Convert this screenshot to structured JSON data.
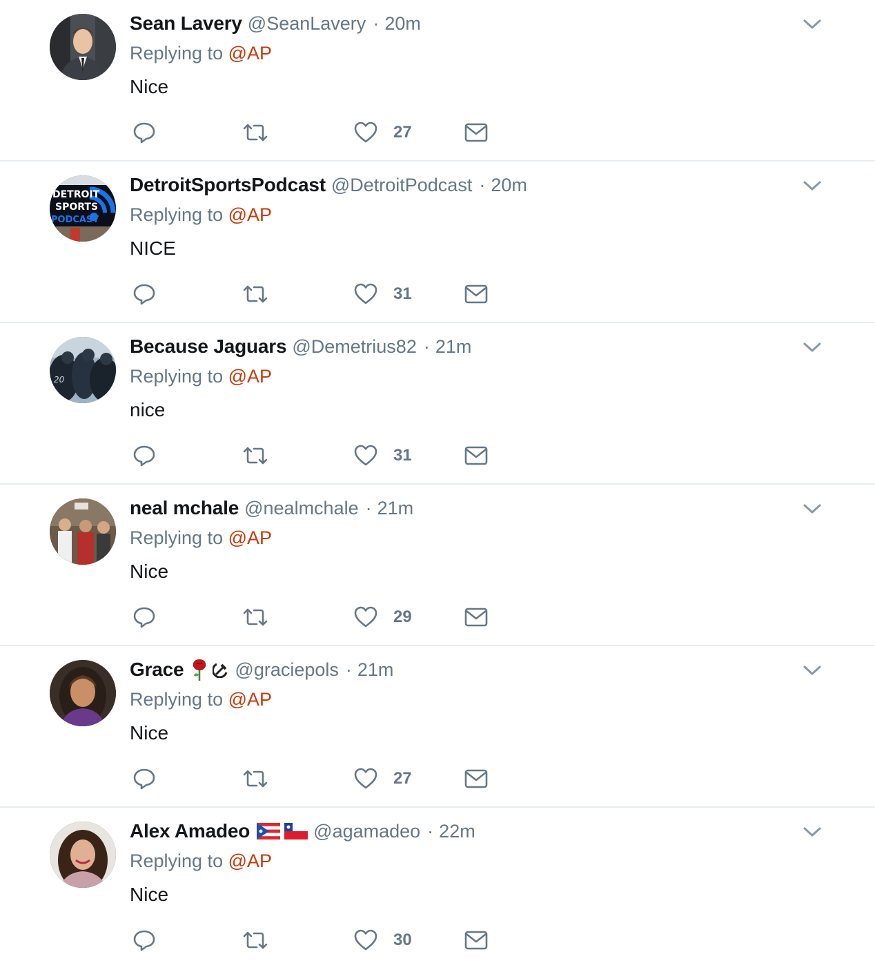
{
  "colors": {
    "reply_mention": "#c93a0a",
    "muted_text": "#657786",
    "primary_text": "#14171a",
    "divider": "#e6ecf0"
  },
  "tweets": [
    {
      "fullname": "Sean Lavery",
      "emoji": [],
      "username": "@SeanLavery",
      "separator": "·",
      "time": "20m",
      "reply_prefix": "Replying to",
      "reply_to": "@AP",
      "text": "Nice",
      "likes": "27",
      "avatar_icon": "avatar-man-suit-icon"
    },
    {
      "fullname": "DetroitSportsPodcast",
      "emoji": [],
      "username": "@DetroitPodcast",
      "separator": "·",
      "time": "20m",
      "reply_prefix": "Replying to",
      "reply_to": "@AP",
      "text": "NICE",
      "likes": "31",
      "avatar_icon": "detroit-sports-podcast-logo",
      "avatar_lines": [
        "DETROIT",
        "SPORTS",
        "PODCAST"
      ]
    },
    {
      "fullname": "Because Jaguars",
      "emoji": [],
      "username": "@Demetrius82",
      "separator": "·",
      "time": "21m",
      "reply_prefix": "Replying to",
      "reply_to": "@AP",
      "text": "nice",
      "likes": "31",
      "avatar_icon": "avatar-football-crowd-icon"
    },
    {
      "fullname": "neal mchale",
      "emoji": [],
      "username": "@nealmchale",
      "separator": "·",
      "time": "21m",
      "reply_prefix": "Replying to",
      "reply_to": "@AP",
      "text": "Nice",
      "likes": "29",
      "avatar_icon": "avatar-group-photo-icon"
    },
    {
      "fullname": "Grace",
      "emoji": [
        "rose-emoji",
        "hammer-sickle-emoji"
      ],
      "username": "@graciepols",
      "separator": "·",
      "time": "21m",
      "reply_prefix": "Replying to",
      "reply_to": "@AP",
      "text": "Nice",
      "likes": "27",
      "avatar_icon": "avatar-woman-portrait-icon"
    },
    {
      "fullname": "Alex Amadeo",
      "emoji": [
        "puerto-rico-flag-emoji",
        "chile-flag-emoji"
      ],
      "username": "@agamadeo",
      "separator": "·",
      "time": "22m",
      "reply_prefix": "Replying to",
      "reply_to": "@AP",
      "text": "Nice",
      "likes": "30",
      "avatar_icon": "avatar-woman-smiling-icon"
    }
  ]
}
